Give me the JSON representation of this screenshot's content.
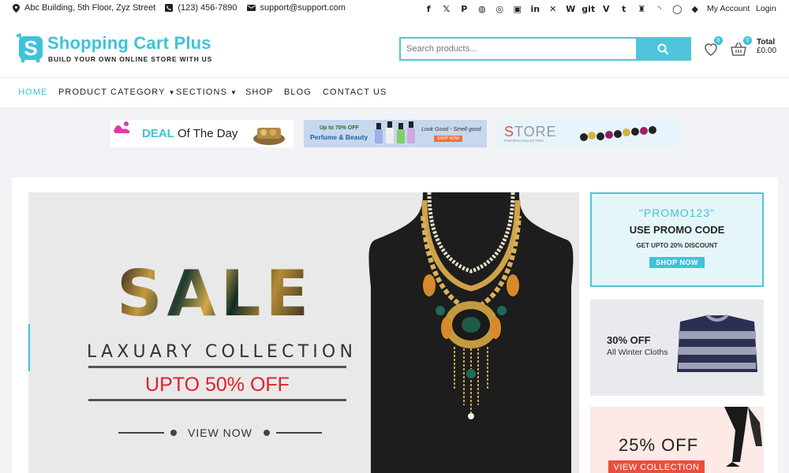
{
  "topbar": {
    "address": "Abc Building, 5th Floor, Zyz Street",
    "phone": "(123) 456-7890",
    "email": "support@support.com",
    "social": [
      "facebook-icon",
      "x-icon",
      "pinterest-icon",
      "dribbble-icon",
      "instagram-icon",
      "flickr-icon",
      "linkedin-icon",
      "xing-icon",
      "wikipedia-icon",
      "git-icon",
      "vine-icon",
      "tumblr-icon",
      "foursquare-icon",
      "feed-icon",
      "whatsapp-icon",
      "dropbox-icon"
    ],
    "social_glyphs": [
      "f",
      "𝕏",
      "P",
      "◍",
      "◎",
      "▣",
      "in",
      "✕",
      "W",
      "git",
      "V",
      "t",
      "♜",
      "◝",
      "◯",
      "◆"
    ],
    "my_account": "My Account",
    "login": "Login"
  },
  "header": {
    "logo_title": "Shopping Cart Plus",
    "logo_subtitle": "BUILD YOUR OWN ONLINE STORE WITH US",
    "search_placeholder": "Search products...",
    "wishlist_count": "0",
    "cart_count": "0",
    "total_label": "Total",
    "total_value": "£0.00"
  },
  "nav": {
    "items": [
      "HOME",
      "PRODUCT CATEGORY",
      "SECTIONS",
      "SHOP",
      "BLOG",
      "CONTACT US"
    ]
  },
  "strip": {
    "deal_a": "DEAL",
    "deal_b": " Of The Day",
    "perfume_a": "Up to 70% OFF",
    "perfume_b": "Perfume & Beauty",
    "perfume_c": "Look Good - Smell good",
    "perfume_btn": "SHOP NOW",
    "store_a": "STORE",
    "store_b": "FASHION COLLECTION"
  },
  "hero": {
    "sale": "SALE",
    "collection": "LAXUARY COLLECTION",
    "offer": "UPTO 50% OFF",
    "cta": "VIEW NOW"
  },
  "promo": {
    "code": "\"PROMO123\"",
    "title": "USE PROMO CODE",
    "sub": "GET UPTO 20% DISCOUNT",
    "btn": "SHOP NOW"
  },
  "winter": {
    "pct": "30% OFF",
    "sub": "All Winter Cloths"
  },
  "off25": {
    "big": "25% OFF",
    "btn": "VIEW COLLECTION"
  },
  "colors": {
    "accent": "#3ec3d8",
    "sale_red": "#e0202a",
    "cta_orange": "#e8503c"
  }
}
